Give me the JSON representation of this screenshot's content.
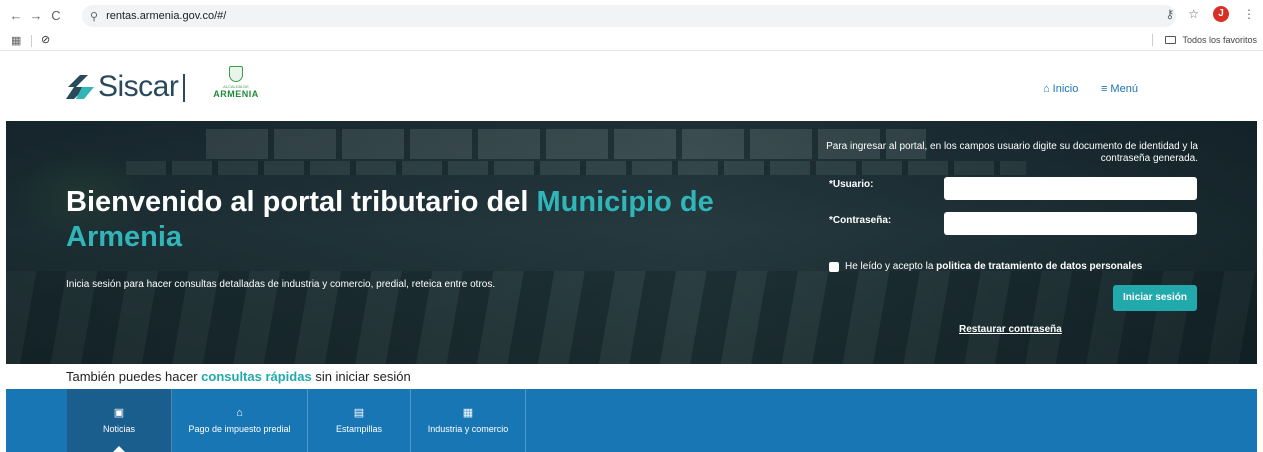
{
  "browser": {
    "url": "rentas.armenia.gov.co/#/",
    "profile_initial": "J",
    "all_bookmarks_label": "Todos los favoritos"
  },
  "header": {
    "logo_text": "Siscar",
    "crest_small": "ALCALDÍA DE",
    "crest_big": "ARMENIA",
    "nav_home": "Inicio",
    "nav_menu": "Menú"
  },
  "hero": {
    "title_prefix": "Bienvenido al portal tributario del ",
    "title_accent": "Municipio de Armenia",
    "subtitle": "Inicia sesión para hacer consultas detalladas de industria y comercio, predial, reteica entre otros."
  },
  "login": {
    "note": "Para ingresar al portal, en los campos usuario digite su documento de identidad y la contraseña generada.",
    "user_label": "*Usuario:",
    "user_value": "",
    "password_label": "*Contraseña:",
    "password_value": "",
    "consent_prefix": "He leído y acepto la ",
    "consent_link": "politica de tratamiento de datos personales",
    "submit_label": "Iniciar sesión",
    "restore_label": "Restaurar contraseña"
  },
  "quick": {
    "prefix": "También puedes hacer ",
    "accent": "consultas rápidas",
    "suffix": " sin iniciar sesión"
  },
  "tabs": [
    {
      "label": "Noticias",
      "icon": "video-icon",
      "active": true
    },
    {
      "label": "Pago de impuesto predial",
      "icon": "home-icon",
      "active": false
    },
    {
      "label": "Estampillas",
      "icon": "document-icon",
      "active": false
    },
    {
      "label": "Industria y comercio",
      "icon": "store-icon",
      "active": false
    }
  ]
}
